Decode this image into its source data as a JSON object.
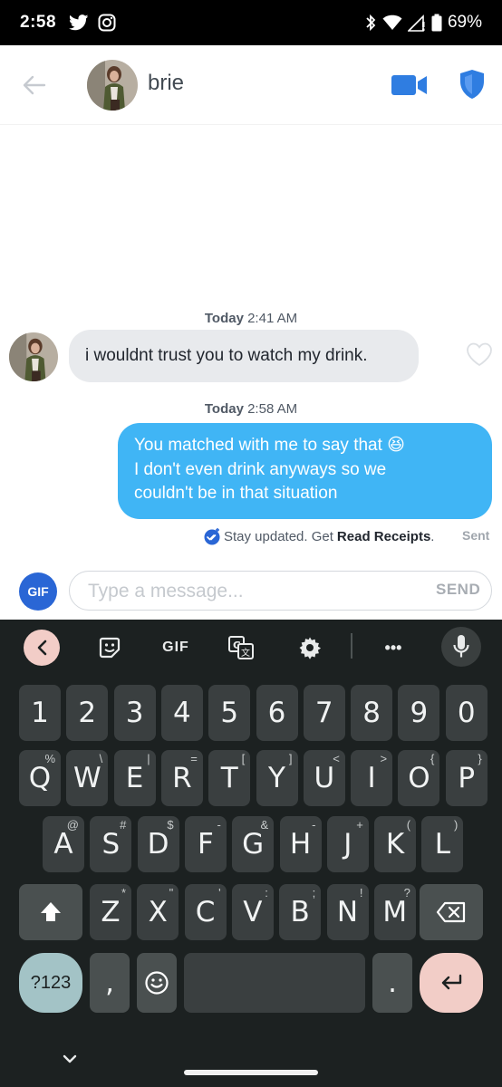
{
  "status_bar": {
    "time": "2:58",
    "battery": "69%"
  },
  "header": {
    "name": "brie"
  },
  "chat": {
    "timestamp_1": {
      "day": "Today",
      "time": "2:41 AM"
    },
    "incoming_message": "i wouldnt trust you to watch my drink.",
    "timestamp_2": {
      "day": "Today",
      "time": "2:58 AM"
    },
    "outgoing_message": "You matched with me to say that 😆\nI don't even drink anyways so we\ncouldn't be in that situation",
    "receipts_prompt": "Stay updated. Get",
    "receipts_link": "Read Receipts",
    "receipts_period": ".",
    "status": "Sent"
  },
  "compose": {
    "gif_label": "GIF",
    "placeholder": "Type a message...",
    "send_label": "SEND"
  },
  "keyboard": {
    "toolbar": {
      "gif_label": "GIF",
      "more_label": "•••"
    },
    "number_row": [
      "1",
      "2",
      "3",
      "4",
      "5",
      "6",
      "7",
      "8",
      "9",
      "0"
    ],
    "row1": [
      {
        "key": "Q",
        "hint": "%"
      },
      {
        "key": "W",
        "hint": "\\"
      },
      {
        "key": "E",
        "hint": "|"
      },
      {
        "key": "R",
        "hint": "="
      },
      {
        "key": "T",
        "hint": "["
      },
      {
        "key": "Y",
        "hint": "]"
      },
      {
        "key": "U",
        "hint": "<"
      },
      {
        "key": "I",
        "hint": ">"
      },
      {
        "key": "O",
        "hint": "{"
      },
      {
        "key": "P",
        "hint": "}"
      }
    ],
    "row2": [
      {
        "key": "A",
        "hint": "@"
      },
      {
        "key": "S",
        "hint": "#"
      },
      {
        "key": "D",
        "hint": "$"
      },
      {
        "key": "F",
        "hint": "-"
      },
      {
        "key": "G",
        "hint": "&"
      },
      {
        "key": "H",
        "hint": "-"
      },
      {
        "key": "J",
        "hint": "+"
      },
      {
        "key": "K",
        "hint": "("
      },
      {
        "key": "L",
        "hint": ")"
      }
    ],
    "row3": [
      {
        "key": "Z",
        "hint": "*"
      },
      {
        "key": "X",
        "hint": "\""
      },
      {
        "key": "C",
        "hint": "'"
      },
      {
        "key": "V",
        "hint": ":"
      },
      {
        "key": "B",
        "hint": ";"
      },
      {
        "key": "N",
        "hint": "!"
      },
      {
        "key": "M",
        "hint": "?"
      }
    ],
    "symbols_label": "?123",
    "comma": ",",
    "period": "."
  }
}
